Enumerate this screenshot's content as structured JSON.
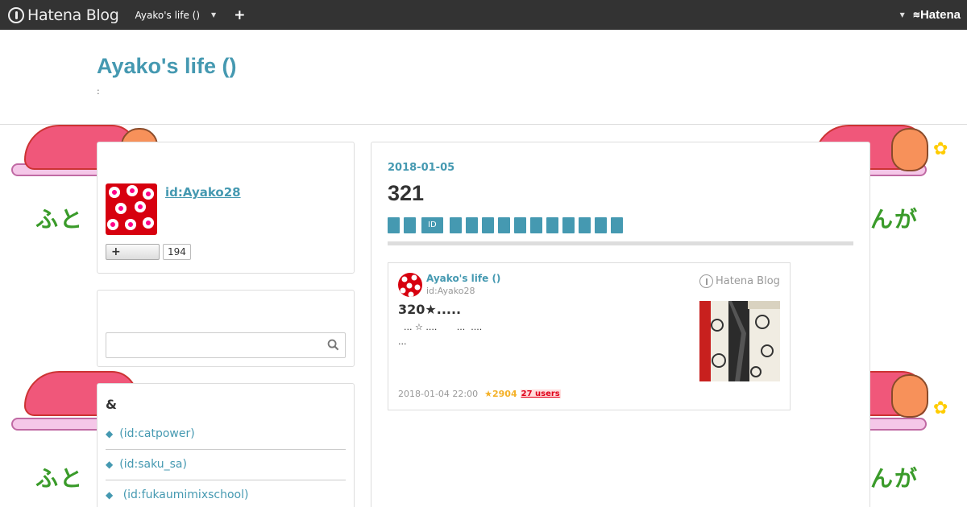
{
  "topbar": {
    "logo": "Hatena Blog",
    "blog_switch": "Ayako's life ()",
    "add": "+",
    "hatena": "Hatena"
  },
  "header": {
    "title": "Ayako's life ()",
    "description": ":"
  },
  "background": {
    "text_left": "ふと",
    "text_right": "んが"
  },
  "profile": {
    "id": "id:Ayako28",
    "follow_label": "+",
    "follower_count": "194"
  },
  "search": {
    "placeholder": ""
  },
  "links": {
    "title": "&",
    "items": [
      "(id:catpower)",
      "(id:saku_sa)",
      "(id:fukaumimixschool)"
    ]
  },
  "post": {
    "date": "2018-01-05",
    "title": "321",
    "tag_id_label": "ID"
  },
  "embed": {
    "blog_name": "Ayako's life ()",
    "blog_id": "id:Ayako28",
    "logo": "Hatena Blog",
    "title": "320★.....",
    "text_line1": "  ... ☆ ....       ...  ....",
    "text_line2": "...",
    "date": "2018-01-04 22:00",
    "stars": "★2904",
    "users": "27 users"
  },
  "colors": {
    "accent": "#4599b1",
    "topbar": "#333333",
    "star": "#f4b128",
    "bookmark_red": "#e0001a"
  }
}
